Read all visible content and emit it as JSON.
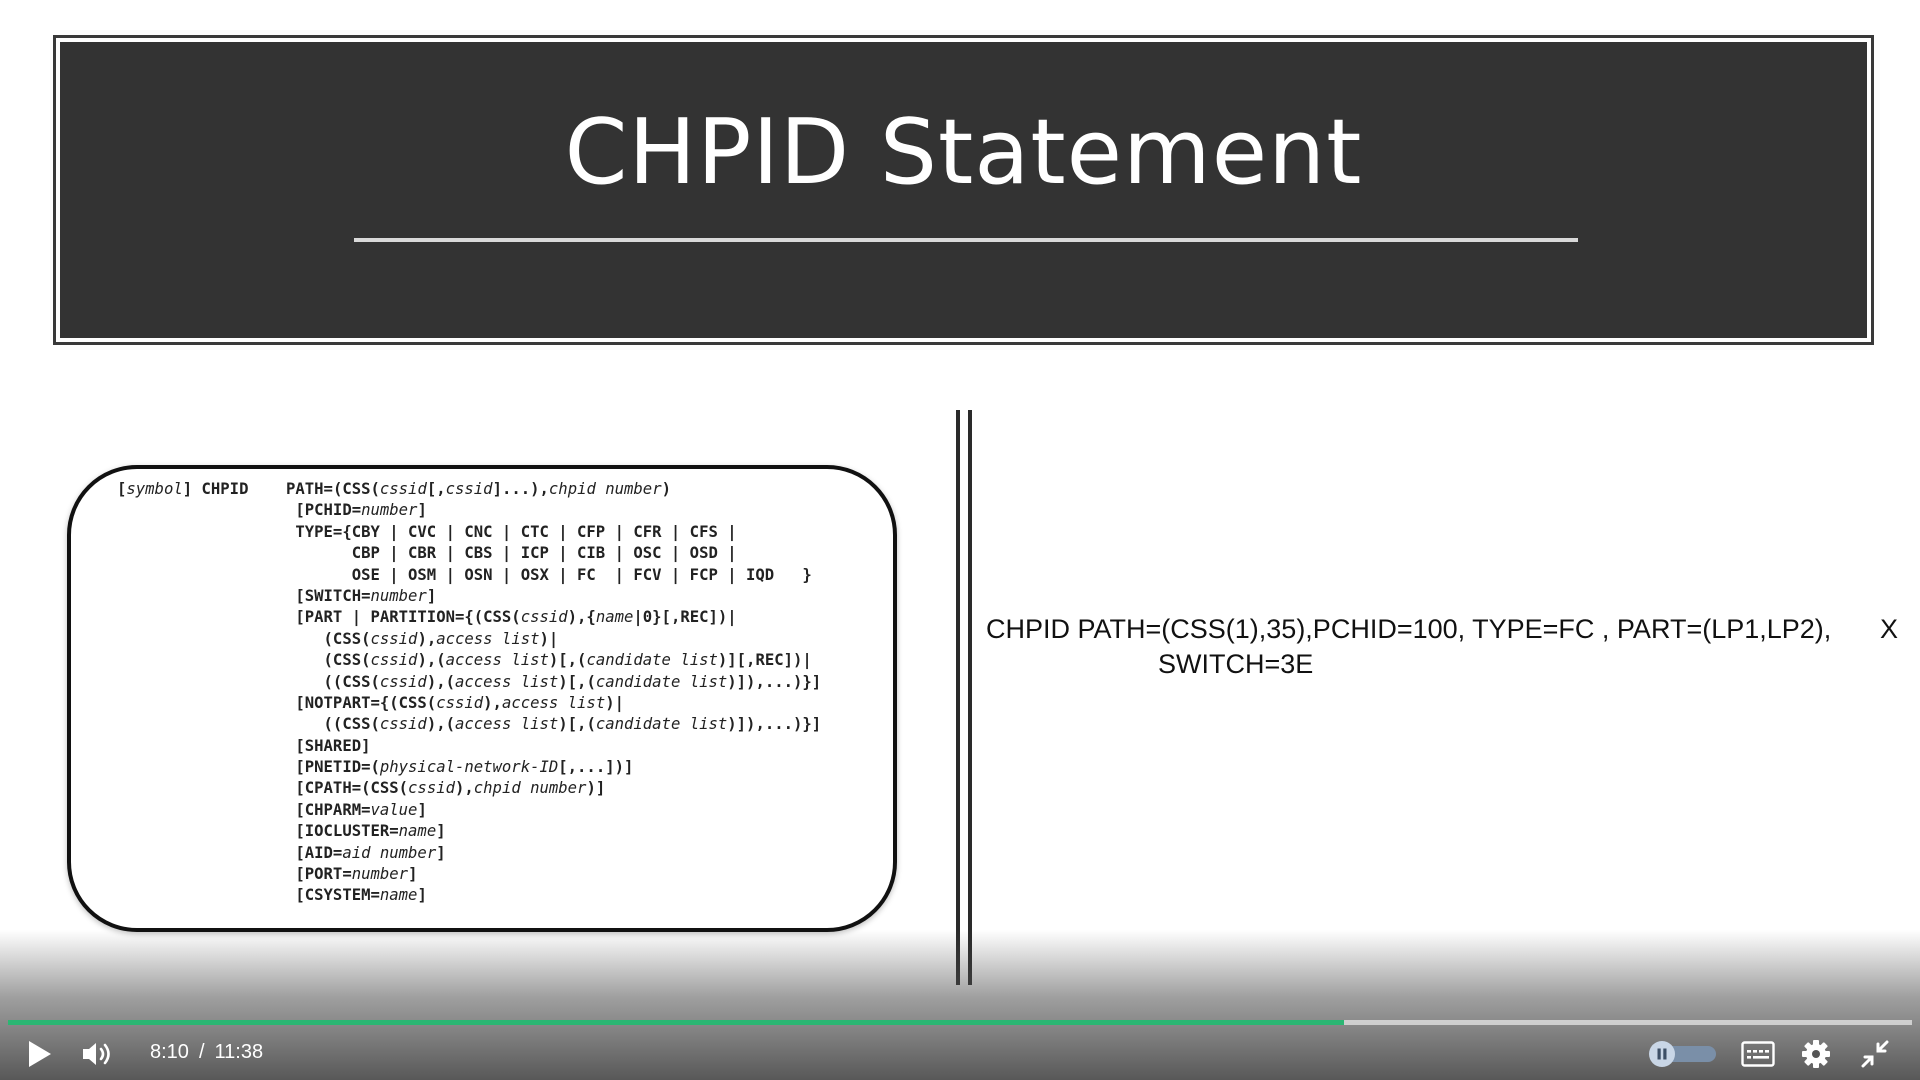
{
  "slide": {
    "title": "CHPID Statement",
    "syntax_lines": [
      [
        {
          "t": "[",
          "s": "k"
        },
        {
          "t": "symbol",
          "s": "i"
        },
        {
          "t": "] CHPID    PATH=(CSS(",
          "s": "k"
        },
        {
          "t": "cssid",
          "s": "i"
        },
        {
          "t": "[,",
          "s": "k"
        },
        {
          "t": "cssid",
          "s": "i"
        },
        {
          "t": "]...),",
          "s": "k"
        },
        {
          "t": "chpid number",
          "s": "i"
        },
        {
          "t": ")",
          "s": "k"
        }
      ],
      [
        {
          "t": "                   [PCHID=",
          "s": "k"
        },
        {
          "t": "number",
          "s": "i"
        },
        {
          "t": "]",
          "s": "k"
        }
      ],
      [
        {
          "t": "                   TYPE={CBY | CVC | CNC | CTC | CFP | CFR | CFS |",
          "s": "k"
        }
      ],
      [
        {
          "t": "                         CBP | CBR | CBS | ICP | CIB | OSC | OSD |",
          "s": "k"
        }
      ],
      [
        {
          "t": "                         OSE | OSM | OSN | OSX | FC  | FCV | FCP | IQD   }",
          "s": "k"
        }
      ],
      [
        {
          "t": "                   [SWITCH=",
          "s": "k"
        },
        {
          "t": "number",
          "s": "i"
        },
        {
          "t": "]",
          "s": "k"
        }
      ],
      [
        {
          "t": "                   [PART | PARTITION={(CSS(",
          "s": "k"
        },
        {
          "t": "cssid",
          "s": "i"
        },
        {
          "t": "),{",
          "s": "k"
        },
        {
          "t": "name",
          "s": "i"
        },
        {
          "t": "|0}[,REC])|",
          "s": "k"
        }
      ],
      [
        {
          "t": "                      (CSS(",
          "s": "k"
        },
        {
          "t": "cssid",
          "s": "i"
        },
        {
          "t": "),",
          "s": "k"
        },
        {
          "t": "access list",
          "s": "i"
        },
        {
          "t": ")|",
          "s": "k"
        }
      ],
      [
        {
          "t": "                      (CSS(",
          "s": "k"
        },
        {
          "t": "cssid",
          "s": "i"
        },
        {
          "t": "),(",
          "s": "k"
        },
        {
          "t": "access list",
          "s": "i"
        },
        {
          "t": ")[,(",
          "s": "k"
        },
        {
          "t": "candidate list",
          "s": "i"
        },
        {
          "t": ")][,REC])|",
          "s": "k"
        }
      ],
      [
        {
          "t": "                      ((CSS(",
          "s": "k"
        },
        {
          "t": "cssid",
          "s": "i"
        },
        {
          "t": "),(",
          "s": "k"
        },
        {
          "t": "access list",
          "s": "i"
        },
        {
          "t": ")[,(",
          "s": "k"
        },
        {
          "t": "candidate list",
          "s": "i"
        },
        {
          "t": ")]),...)}]",
          "s": "k"
        }
      ],
      [
        {
          "t": "                   [NOTPART={(CSS(",
          "s": "k"
        },
        {
          "t": "cssid",
          "s": "i"
        },
        {
          "t": "),",
          "s": "k"
        },
        {
          "t": "access list",
          "s": "i"
        },
        {
          "t": ")|",
          "s": "k"
        }
      ],
      [
        {
          "t": "                      ((CSS(",
          "s": "k"
        },
        {
          "t": "cssid",
          "s": "i"
        },
        {
          "t": "),(",
          "s": "k"
        },
        {
          "t": "access list",
          "s": "i"
        },
        {
          "t": ")[,(",
          "s": "k"
        },
        {
          "t": "candidate list",
          "s": "i"
        },
        {
          "t": ")]),...)}]",
          "s": "k"
        }
      ],
      [
        {
          "t": "                   [SHARED]",
          "s": "k"
        }
      ],
      [
        {
          "t": "                   [PNETID=(",
          "s": "k"
        },
        {
          "t": "physical-network-ID",
          "s": "i"
        },
        {
          "t": "[,...])]",
          "s": "k"
        }
      ],
      [
        {
          "t": "                   [CPATH=(CSS(",
          "s": "k"
        },
        {
          "t": "cssid",
          "s": "i"
        },
        {
          "t": "),",
          "s": "k"
        },
        {
          "t": "chpid number",
          "s": "i"
        },
        {
          "t": ")]",
          "s": "k"
        }
      ],
      [
        {
          "t": "                   [CHPARM=",
          "s": "k"
        },
        {
          "t": "value",
          "s": "i"
        },
        {
          "t": "]",
          "s": "k"
        }
      ],
      [
        {
          "t": "                   [IOCLUSTER=",
          "s": "k"
        },
        {
          "t": "name",
          "s": "i"
        },
        {
          "t": "]",
          "s": "k"
        }
      ],
      [
        {
          "t": "                   [AID=",
          "s": "k"
        },
        {
          "t": "aid number",
          "s": "i"
        },
        {
          "t": "]",
          "s": "k"
        }
      ],
      [
        {
          "t": "                   [PORT=",
          "s": "k"
        },
        {
          "t": "number",
          "s": "i"
        },
        {
          "t": "]",
          "s": "k"
        }
      ],
      [
        {
          "t": "                   [CSYSTEM=",
          "s": "k"
        },
        {
          "t": "name",
          "s": "i"
        },
        {
          "t": "]",
          "s": "k"
        }
      ]
    ],
    "example": {
      "line1": "CHPID PATH=(CSS(1),35),PCHID=100, TYPE=FC , PART=(LP1,LP2),",
      "line2": "SWITCH=3E",
      "continuation": "X"
    }
  },
  "player": {
    "current_time": "8:10",
    "time_separator": "/",
    "duration": "11:38",
    "progress": 0.7017,
    "accent_color": "#2bb673",
    "icons": {
      "play": "play-icon",
      "volume": "volume-icon",
      "speed_toggle": "pause-toggle-icon",
      "captions": "captions-icon",
      "settings": "gear-icon",
      "exit_fullscreen": "exit-fullscreen-icon"
    }
  }
}
